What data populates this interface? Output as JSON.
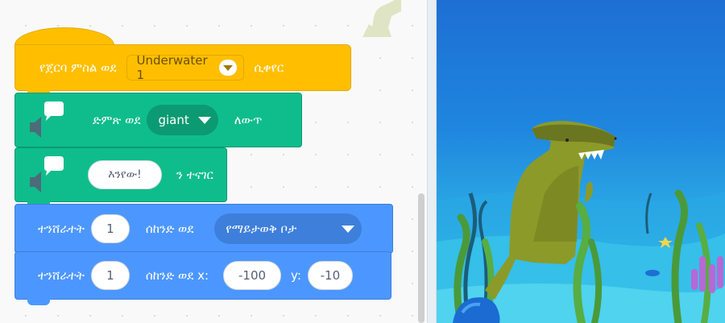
{
  "looks_block": {
    "prefix": "የጀርባ ምስል ወደ",
    "backdrop_value": "Underwater 1",
    "suffix": "ሲቀየር"
  },
  "sound_effect_block": {
    "prefix": "ድምጽ ወደ",
    "effect_value": "giant",
    "suffix": "ለውጥ"
  },
  "say_block": {
    "message": "እንየው!",
    "suffix": "ን ተናገር"
  },
  "glide_random_block": {
    "prefix": "ተንሸራተት",
    "seconds": "1",
    "middle": "ሰከንድ ወደ",
    "target_value": "የማይታወቅ ቦታ"
  },
  "glide_xy_block": {
    "prefix": "ተንሸራተት",
    "seconds": "1",
    "middle": "ሰከንድ ወደ x:",
    "x_value": "-100",
    "y_label": "y:",
    "y_value": "-10"
  },
  "colors": {
    "looks": "#ffbf00",
    "sound": "#0fbd8c",
    "motion": "#4c97ff",
    "stage_water": "#1f86df"
  },
  "icons": {
    "speaker": "speaker-icon",
    "speech": "speech-bubble-icon",
    "dropdown": "chevron-down-icon"
  }
}
